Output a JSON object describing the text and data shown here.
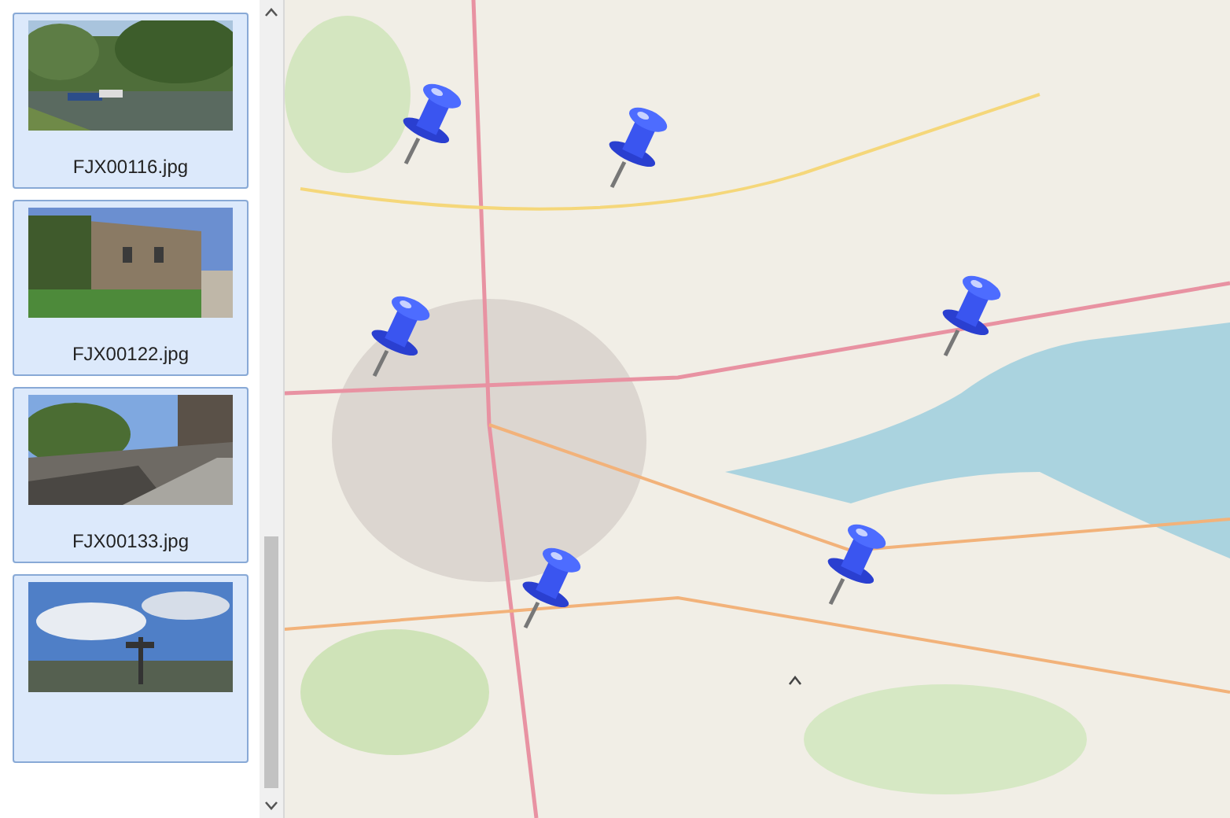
{
  "thumbnails": [
    {
      "filename": "FJX00116.jpg",
      "kind": "picture",
      "selected": false
    },
    {
      "filename": "FJX00122.jpg",
      "kind": "picture",
      "selected": false
    },
    {
      "filename": "FJX00133.jpg",
      "kind": "picture",
      "selected": false
    },
    {
      "kind": "picture",
      "selected": false
    }
  ],
  "map": {
    "kind": "picture"
  }
}
